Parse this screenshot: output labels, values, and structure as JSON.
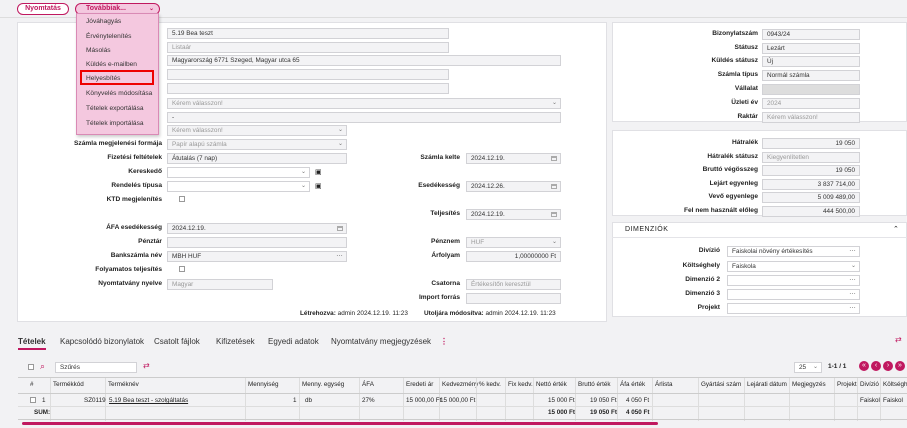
{
  "toolbar": {
    "print": "Nyomtatás",
    "more": "Továbbiak..."
  },
  "menu": {
    "items": [
      "Jóváhagyás",
      "Érvénytelenítés",
      "Másolás",
      "Küldés e-mailben",
      "Helyesbítés",
      "Könyvelés módosítása",
      "Tételek exportálása",
      "Tételek importálása"
    ],
    "highlighted": "Helyesbítés"
  },
  "form": {
    "partner_name": "5.19 Bea teszt",
    "partner_type": "Listaár",
    "address": "Magyarország 6771 Szeged, Magyar utca 65",
    "select_placeholder": "Kérem válasszon!",
    "dash": "-",
    "select_placeholder2": "Kérem válasszon!",
    "invoice_form_label": "Számla megjelenési formája",
    "invoice_form_value": "Papír alapú számla",
    "payment_terms_label": "Fizetési feltételek",
    "payment_terms_value": "Átutalás (7 nap)",
    "invoice_date_label": "Számla kelte",
    "invoice_date_value": "2024.12.19.",
    "dealer_label": "Kereskedő",
    "order_type_label": "Rendelés típusa",
    "due_label": "Esedékesség",
    "due_value": "2024.12.26.",
    "ktd_label": "KTD megjelenítés",
    "performance_label": "Teljesítés",
    "performance_value": "2024.12.19.",
    "vat_due_label": "ÁFA esedékesség",
    "vat_due_value": "2024.12.19.",
    "cashdesk_label": "Pénztár",
    "currency_label": "Pénznem",
    "currency_value": "HUF",
    "bank_label": "Bankszámla név",
    "bank_value": "MBH HUF",
    "rate_label": "Árfolyam",
    "rate_value": "1,00000000 Ft",
    "continuous_label": "Folyamatos teljesítés",
    "print_lang_label": "Nyomtatvány nyelve",
    "print_lang_value": "Magyar",
    "channel_label": "Csatorna",
    "channel_value": "Értékesítőn keresztül",
    "source_label": "Import forrás",
    "created_label": "Létrehozva:",
    "created_value": "admin 2024.12.19. 11:23",
    "modified_label": "Utoljára módosítva:",
    "modified_value": "admin 2024.12.19. 11:23"
  },
  "doc_info": [
    {
      "label": "Bizonylatszám",
      "value": "0943/24",
      "ph": false
    },
    {
      "label": "Státusz",
      "value": "Lezárt",
      "ph": false
    },
    {
      "label": "Küldés státusz",
      "value": "Új",
      "ph": false
    },
    {
      "label": "Számla típus",
      "value": "Normál számla",
      "ph": false
    },
    {
      "label": "Vállalat",
      "value": "",
      "ph": false
    },
    {
      "label": "Üzleti év",
      "value": "2024",
      "ph": true
    },
    {
      "label": "Raktár",
      "value": "Kérem válasszon!",
      "ph": true
    }
  ],
  "balances": [
    {
      "label": "Hátralék",
      "value": "19 050"
    },
    {
      "label": "Hátralék státusz",
      "value": "Kiegyenlítetlen"
    },
    {
      "label": "Bruttó végösszeg",
      "value": "19 050"
    },
    {
      "label": "Lejárt egyenleg",
      "value": "3 837 714,00"
    },
    {
      "label": "Vevő egyenlege",
      "value": "5 009 489,00"
    },
    {
      "label": "Fel nem használt előleg",
      "value": "444 500,00"
    }
  ],
  "dimension": {
    "title": "DIMENZIÓK",
    "rows": [
      {
        "label": "Divízió",
        "value": "Faiskolai növény értékesítés"
      },
      {
        "label": "Költséghely",
        "value": "Faiskola"
      },
      {
        "label": "Dimenzió 2",
        "value": ""
      },
      {
        "label": "Dimenzió 3",
        "value": ""
      },
      {
        "label": "Projekt",
        "value": ""
      }
    ]
  },
  "tabs": [
    "Tételek",
    "Kapcsolódó bizonylatok",
    "Csatolt fájlok",
    "Kifizetések",
    "Egyedi adatok",
    "Nyomtatvány megjegyzések"
  ],
  "grid": {
    "filter_placeholder": "Szűrés",
    "page_size": "25",
    "pager": "1-1 / 1",
    "columns": [
      "#",
      "Termékkód",
      "Terméknév",
      "Mennyiség",
      "Menny. egység",
      "ÁFA",
      "Eredeti ár",
      "Kedvezmény",
      "% kedv.",
      "Fix kedv.",
      "Nettó érték",
      "Bruttó érték",
      "Áfa érték",
      "Árlista",
      "Gyártási szám",
      "Lejárati dátum",
      "Megjegyzés",
      "Projekt",
      "Divízió",
      "Költséghely"
    ],
    "row": {
      "num": "1",
      "code": "SZ0119",
      "name": "5.19 Bea teszt - szolgáltatás",
      "qty": "1",
      "unit": "db",
      "vat": "27%",
      "orig": "15 000,00 Ft",
      "disc": "15 000,00 Ft",
      "net": "15 000 Ft",
      "gross": "19 050 Ft",
      "vatv": "4 050 Ft",
      "div": "Faiskol",
      "cost": "Faiskol"
    },
    "sum_label": "SUM:",
    "sum_net": "15 000 Ft",
    "sum_gross": "19 050 Ft",
    "sum_vat": "4 050 Ft"
  },
  "colors": {
    "accent": "#c0185f",
    "menu_bg": "#f4c8df",
    "highlight": "#ee0000"
  }
}
